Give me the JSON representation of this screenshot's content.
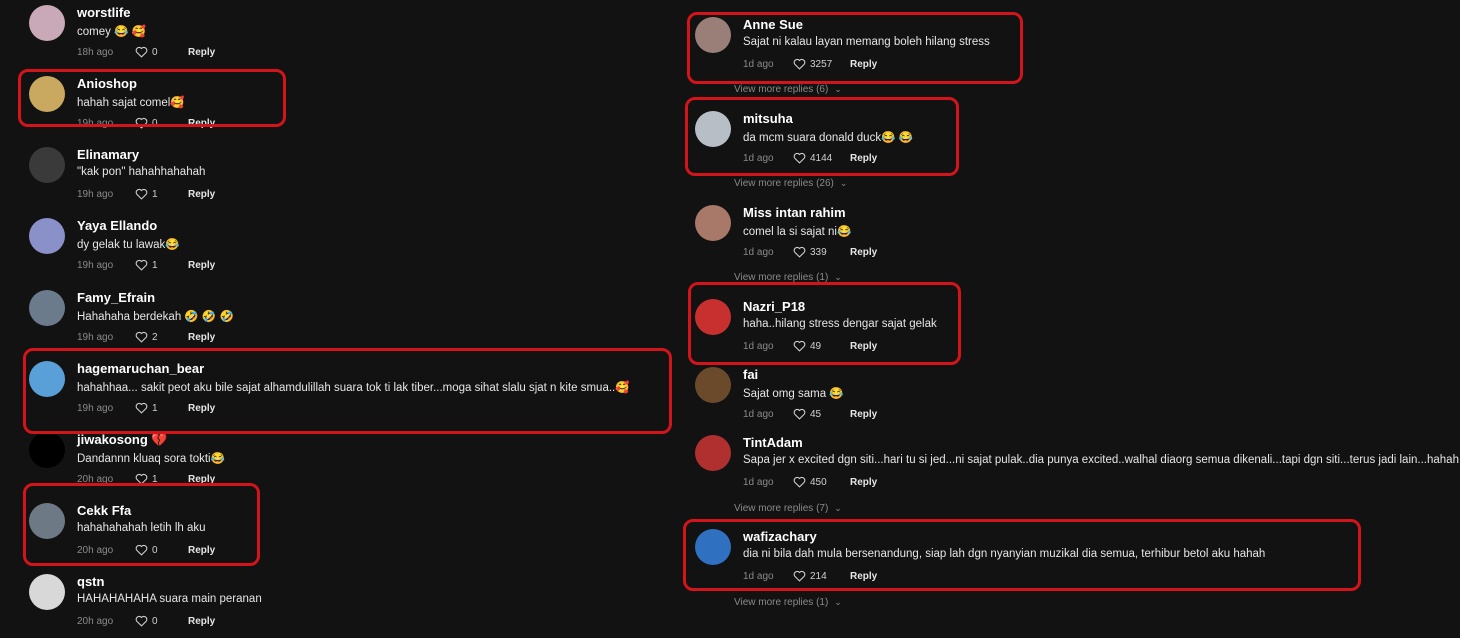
{
  "left_comments": [
    {
      "username": "worstlife",
      "text": "comey 😂 🥰",
      "time": "18h ago",
      "likes": "0",
      "reply": "Reply",
      "avatar_color": "#c9a9b7"
    },
    {
      "username": "Anioshop",
      "text": "hahah sajat comel🥰",
      "time": "19h ago",
      "likes": "0",
      "reply": "Reply",
      "avatar_color": "#c9a85f"
    },
    {
      "username": "Elinamary",
      "text": "\"kak pon\" hahahhahahah",
      "time": "19h ago",
      "likes": "1",
      "reply": "Reply",
      "avatar_color": "#3a3a3a"
    },
    {
      "username": "Yaya  Ellando",
      "text": "dy gelak tu lawak😂",
      "time": "19h ago",
      "likes": "1",
      "reply": "Reply",
      "avatar_color": "#8a90c8"
    },
    {
      "username": "Famy_Efrain",
      "text": "Hahahaha berdekah 🤣 🤣 🤣",
      "time": "19h ago",
      "likes": "2",
      "reply": "Reply",
      "avatar_color": "#6b7b8c"
    },
    {
      "username": "hagemaruchan_bear",
      "text": "hahahhaa... sakit peot aku bile sajat alhamdulillah suara tok ti lak tiber...moga sihat slalu sjat n kite smua..🥰",
      "time": "19h ago",
      "likes": "1",
      "reply": "Reply",
      "avatar_color": "#5aa0d8"
    },
    {
      "username": "jiwakosong",
      "text": "Dandannn kluaq sora tokti😂",
      "time": "20h ago",
      "likes": "1",
      "reply": "Reply",
      "avatar_color": "#000000",
      "badge": "💔"
    },
    {
      "username": "Cekk Ffa",
      "text": "hahahahahah letih lh aku",
      "time": "20h ago",
      "likes": "0",
      "reply": "Reply",
      "avatar_color": "#6d7a85"
    },
    {
      "username": "qstn",
      "text": "HAHAHAHAHA suara main peranan",
      "time": "20h ago",
      "likes": "0",
      "reply": "Reply",
      "avatar_color": "#d8d8d8"
    }
  ],
  "right_comments": [
    {
      "username": "Anne Sue",
      "text": "Sajat ni kalau layan memang boleh hilang stress",
      "time": "1d ago",
      "likes": "3257",
      "reply": "Reply",
      "avatar_color": "#9a7f78",
      "view_more": "View more replies (6)"
    },
    {
      "username": "mitsuha",
      "text": "da mcm suara donald duck😂 😂",
      "time": "1d ago",
      "likes": "4144",
      "reply": "Reply",
      "avatar_color": "#b8bec6",
      "view_more": "View more replies (26)"
    },
    {
      "username": "Miss intan rahim",
      "text": "comel la si sajat ni😂",
      "time": "1d ago",
      "likes": "339",
      "reply": "Reply",
      "avatar_color": "#a87868",
      "view_more": "View more replies (1)"
    },
    {
      "username": "Nazri_P18",
      "text": "haha..hilang stress dengar sajat gelak",
      "time": "1d ago",
      "likes": "49",
      "reply": "Reply",
      "avatar_color": "#c83030"
    },
    {
      "username": "fai",
      "text": "Sajat omg sama 😂",
      "time": "1d ago",
      "likes": "45",
      "reply": "Reply",
      "avatar_color": "#6a4a2a"
    },
    {
      "username": "TintAdam",
      "text": "Sapa jer x excited dgn siti...hari tu si jed...ni sajat pulak..dia punya excited..walhal diaorg semua dikenali...tapi dgn siti...terus jadi lain...hahah",
      "time": "1d ago",
      "likes": "450",
      "reply": "Reply",
      "avatar_color": "#b03030",
      "view_more": "View more replies (7)"
    },
    {
      "username": "wafizachary",
      "text": "dia ni bila dah mula bersenandung, siap lah dgn nyanyian muzikal dia semua, terhibur betol aku hahah",
      "time": "1d ago",
      "likes": "214",
      "reply": "Reply",
      "avatar_color": "#3070c0",
      "view_more": "View more replies (1)"
    }
  ],
  "colors": {
    "background": "#121212",
    "highlight": "#d4141b",
    "muted": "#8a8a8a"
  },
  "icons": {
    "like": "heart-outline-icon",
    "expand": "chevron-down-icon"
  }
}
